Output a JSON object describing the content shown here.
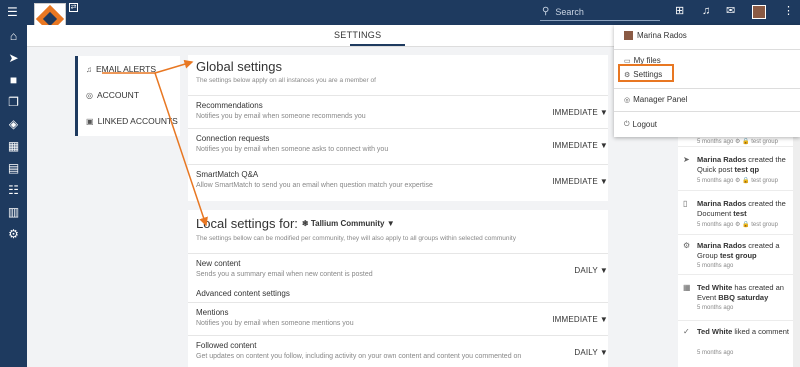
{
  "topbar": {
    "search_placeholder": "Search",
    "menu_icon": "hamburger-icon",
    "icons": [
      "sitemap-icon",
      "bell-icon",
      "mail-icon",
      "kebab-menu-icon"
    ]
  },
  "sidebar": {
    "items": [
      "home-icon",
      "send-icon",
      "comment-icon",
      "copy-icon",
      "layers-icon",
      "building-icon",
      "calendar-icon",
      "list-icon",
      "calendar-alt-icon",
      "gear-icon"
    ]
  },
  "tabs": {
    "settings": "SETTINGS"
  },
  "leftnav": {
    "items": [
      {
        "label": "EMAIL ALERTS",
        "icon": "bell-icon"
      },
      {
        "label": "ACCOUNT",
        "icon": "user-circle-icon"
      },
      {
        "label": "LINKED ACCOUNTS",
        "icon": "lock-icon"
      }
    ]
  },
  "global": {
    "title": "Global settings",
    "subtitle": "The settings below apply on all instances you are a member of",
    "rows": [
      {
        "title": "Recommendations",
        "desc": "Notifies you by email when someone recommends you",
        "value": "IMMEDIATE"
      },
      {
        "title": "Connection requests",
        "desc": "Notifies you by email when someone asks to connect with you",
        "value": "IMMEDIATE"
      },
      {
        "title": "SmartMatch Q&A",
        "desc": "Allow SmartMatch to send you an email when question match your expertise",
        "value": "IMMEDIATE"
      }
    ]
  },
  "local": {
    "title": "Local settings for:",
    "community": "Tallium Community",
    "subtitle": "The settings bellow can be modified per community, they will also apply to all groups within selected community",
    "rows": [
      {
        "title": "New content",
        "desc": "Sends you a summary email when new content is posted",
        "value": "DAILY"
      },
      {
        "title": "Mentions",
        "desc": "Notifies you by email when someone mentions you",
        "value": "IMMEDIATE"
      },
      {
        "title": "Followed content",
        "desc": "Get updates on content you follow, including activity on your own content and content you commented on",
        "value": "DAILY"
      }
    ],
    "advanced": "Advanced content settings"
  },
  "dropdown": {
    "user": "Marina Rados",
    "items": [
      {
        "label": "My files",
        "icon": "folder-icon"
      },
      {
        "label": "Settings",
        "icon": "gear-icon"
      },
      {
        "label": "Manager Panel",
        "icon": "user-circle-icon"
      },
      {
        "label": "Logout",
        "icon": "logout-icon"
      }
    ]
  },
  "feed": {
    "items": [
      {
        "meta": "5 months ago",
        "group": "test group",
        "icon": ""
      },
      {
        "actor": "Marina Rados",
        "text": " created the Quick post ",
        "object": "test qp",
        "meta": "5 months ago",
        "group": "test group",
        "icon": "send-icon"
      },
      {
        "actor": "Marina Rados",
        "text": " created the Document ",
        "object": "test",
        "meta": "5 months ago",
        "group": "test group",
        "icon": "document-icon"
      },
      {
        "actor": "Marina Rados",
        "text": " created a Group ",
        "object": "test group",
        "meta": "5 months ago",
        "icon": "gear-icon"
      },
      {
        "actor": "Ted White",
        "text": " has created an Event ",
        "object": "BBQ saturday",
        "meta": "5 months ago",
        "icon": "calendar-icon"
      },
      {
        "actor": "Ted White",
        "text": " liked a comment",
        "object": "",
        "meta": "5 months ago",
        "icon": "check-icon"
      }
    ]
  },
  "colors": {
    "navy": "#1e3a5f",
    "orange": "#e87722"
  }
}
